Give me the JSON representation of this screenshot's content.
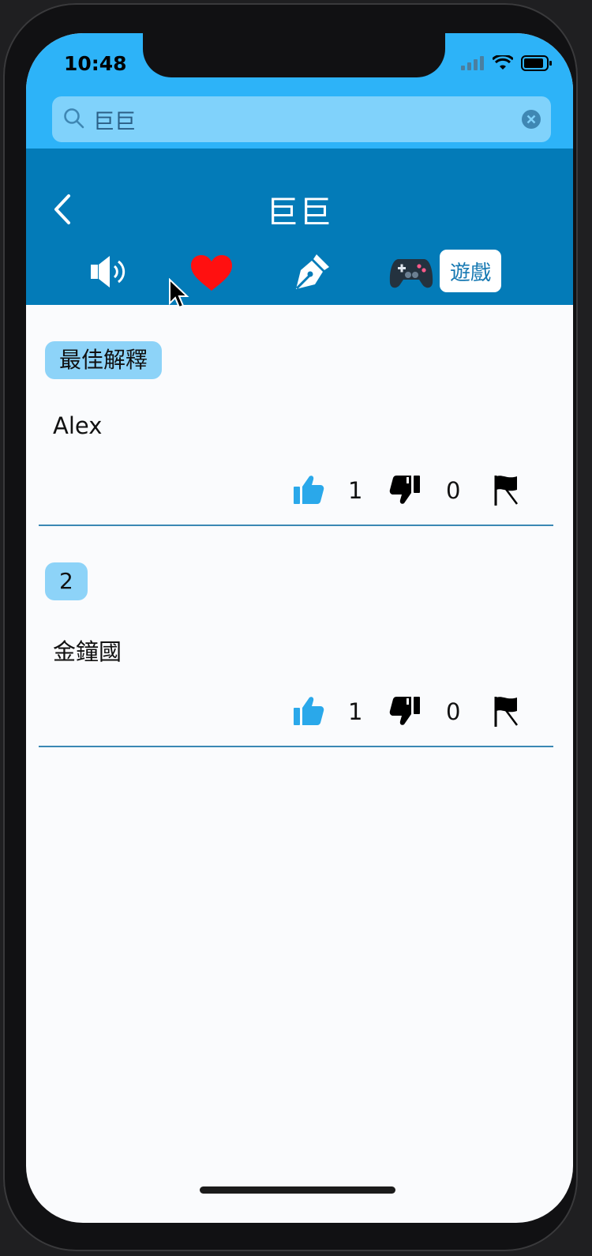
{
  "status_bar": {
    "time": "10:48"
  },
  "search": {
    "query": "巨巨"
  },
  "header": {
    "title": "巨巨",
    "tools": {
      "speaker_icon": "speaker-icon",
      "heart_icon": "heart-icon",
      "pen_icon": "pen-nib-icon",
      "game_icon": "game-controller-icon",
      "games_label": "遊戲"
    }
  },
  "entries": [
    {
      "tag": "最佳解釋",
      "text": "Alex",
      "likes": "1",
      "dislikes": "0"
    },
    {
      "tag": "2",
      "text": "金鐘國",
      "likes": "1",
      "dislikes": "0"
    }
  ],
  "colors": {
    "status_bar": "#2db3f8",
    "header": "#037bb8",
    "tag": "#8dd3f8",
    "like": "#2aa8ea",
    "heart": "#ff1010"
  }
}
